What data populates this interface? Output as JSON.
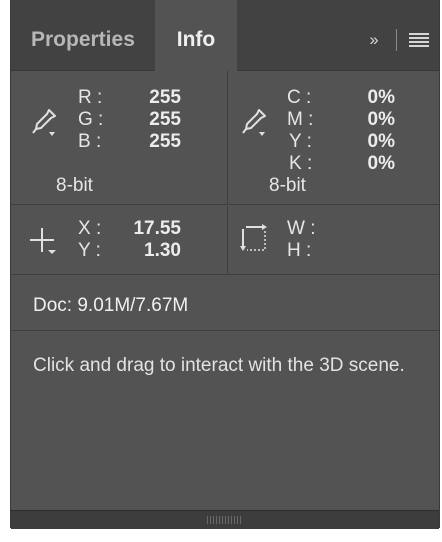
{
  "tabs": [
    {
      "label": "Properties",
      "active": false
    },
    {
      "label": "Info",
      "active": true
    }
  ],
  "toolbar": {
    "collapse_icon": "double-chevron-right-icon",
    "collapse_glyph": "››",
    "menu_icon": "hamburger-menu-icon"
  },
  "rgb": {
    "r_label": "R :",
    "r_value": "255",
    "g_label": "G :",
    "g_value": "255",
    "b_label": "B :",
    "b_value": "255",
    "depth": "8-bit"
  },
  "cmyk": {
    "c_label": "C :",
    "c_value": "0%",
    "m_label": "M :",
    "m_value": "0%",
    "y_label": "Y :",
    "y_value": "0%",
    "k_label": "K :",
    "k_value": "0%",
    "depth": "8-bit"
  },
  "position": {
    "x_label": "X :",
    "x_value": "17.55",
    "y_label": "Y :",
    "y_value": "1.30"
  },
  "size": {
    "w_label": "W :",
    "w_value": "",
    "h_label": "H :",
    "h_value": ""
  },
  "doc": "Doc: 9.01M/7.67M",
  "hint": "Click and drag to interact with the 3D scene.",
  "colors": {
    "panel_bg": "#535353",
    "tabbar_bg": "#424242",
    "text": "#e6e6e6"
  }
}
